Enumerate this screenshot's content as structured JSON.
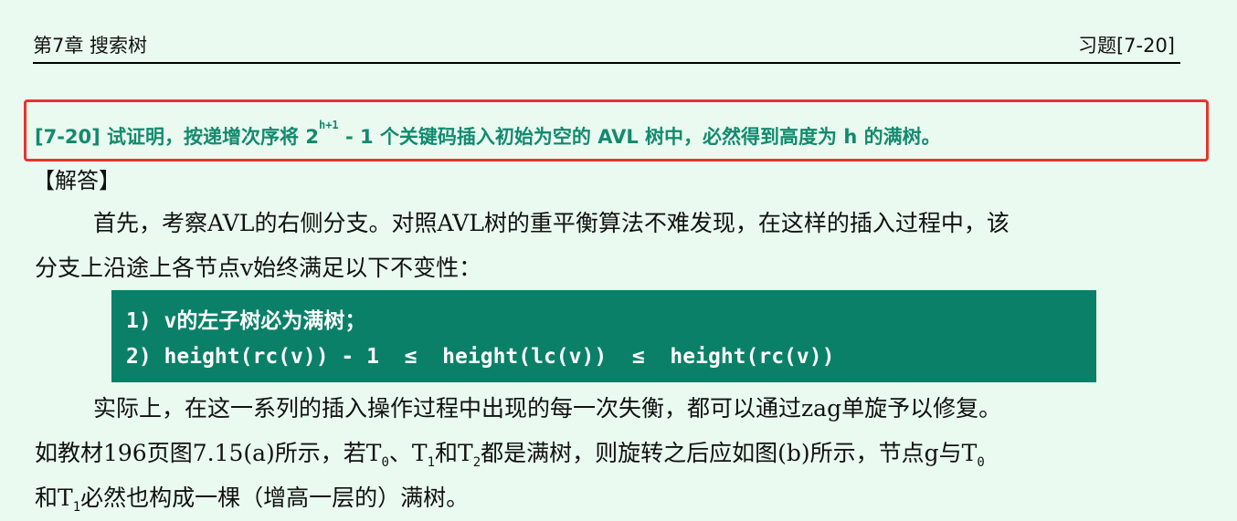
{
  "header": {
    "chapter": "第7章  搜索树",
    "exercise_id": "习题[7-20]"
  },
  "problem": {
    "prefix": "[7-20] 试证明，按递增次序将 2",
    "exponent": "h+1",
    "middle": " - 1 个关键码插入初始为空的 AVL 树中，必然得到高度为 h 的满树。"
  },
  "answer": {
    "label": "【解答】",
    "para1_line1": "首先，考察AVL的右侧分支。对照AVL树的重平衡算法不难发现，在这样的插入过程中，该",
    "para1_line2": "分支上沿途上各节点v始终满足以下不变性：",
    "invariants": [
      "1) v的左子树必为满树；",
      "2) height(rc(v)) - 1  ≤  height(lc(v))  ≤  height(rc(v))"
    ],
    "para2_line1": "实际上，在这一系列的插入操作过程中出现的每一次失衡，都可以通过zag单旋予以修复。",
    "para2_line2_a": "如教材196页图7.15(a)所示，若T",
    "para2_line2_sub0": "0",
    "para2_line2_b": "、T",
    "para2_line2_sub1": "1",
    "para2_line2_c": "和T",
    "para2_line2_sub2": "2",
    "para2_line2_d": "都是满树，则旋转之后应如图(b)所示，节点g与T",
    "para2_line2_sub3": "0",
    "para2_line3_a": "和T",
    "para2_line3_sub": "1",
    "para2_line3_b": "必然也构成一棵（增高一层的）满树。"
  },
  "colors": {
    "background": "#eafaf0",
    "problem_text": "#138a6e",
    "highlight_border": "#e8332d",
    "code_bg": "#0a8068"
  }
}
